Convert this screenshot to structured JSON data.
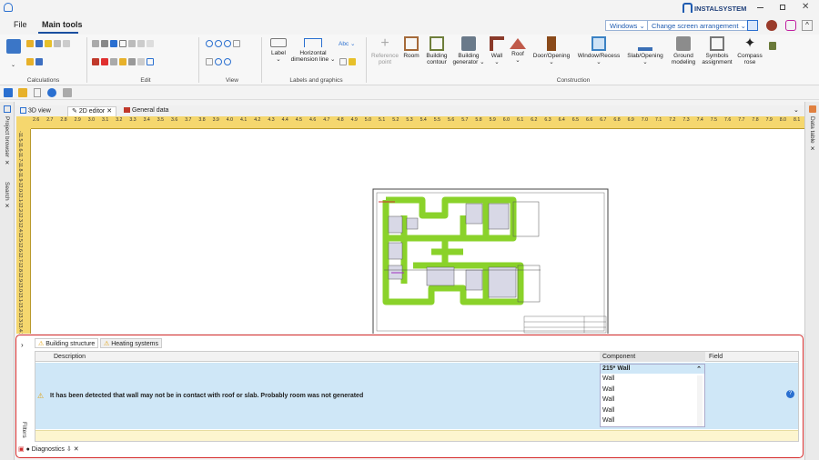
{
  "app": {
    "logo_text": "INSTALSYSTEM"
  },
  "menu": {
    "file": "File",
    "main_tools": "Main tools"
  },
  "topbar": {
    "windows": "Windows",
    "arrangement": "Change screen arrangement"
  },
  "ribbon": {
    "groups": {
      "calculations": "Calculations",
      "edit": "Edit",
      "view": "View",
      "labels": "Labels and graphics",
      "construction": "Construction"
    },
    "labels_buttons": {
      "label": "Label",
      "hdim": "Horizontal dimension line",
      "abc": "Abc"
    },
    "construction_buttons": {
      "reference_point": "Reference point",
      "room": "Room",
      "building_contour": "Building contour",
      "building_generator": "Building generator",
      "wall": "Wall",
      "roof": "Roof",
      "door_opening": "Door/Opening",
      "window_recess": "Window/Recess",
      "slab_opening": "Slab/Opening",
      "ground_modeling": "Ground modeling",
      "symbols_assignment": "Symbols assignment",
      "compass_rose": "Compass rose"
    }
  },
  "tabs": {
    "view3d": "3D view",
    "editor2d": "2D editor",
    "general": "General data"
  },
  "side": {
    "project_browser": "Project browser",
    "search": "Search",
    "data_table": "Data table",
    "filters": "Filters"
  },
  "ruler": {
    "top": [
      "2.6",
      "2.7",
      "2.8",
      "2.9",
      "3.0",
      "3.1",
      "3.2",
      "3.3",
      "3.4",
      "3.5",
      "3.6",
      "3.7",
      "3.8",
      "3.9",
      "4.0",
      "4.1",
      "4.2",
      "4.3",
      "4.4",
      "4.5",
      "4.6",
      "4.7",
      "4.8",
      "4.9",
      "5.0",
      "5.1",
      "5.2",
      "5.3",
      "5.4",
      "5.5",
      "5.6",
      "5.7",
      "5.8",
      "5.9",
      "6.0",
      "6.1",
      "6.2",
      "6.3",
      "6.4",
      "6.5",
      "6.6",
      "6.7",
      "6.8",
      "6.9",
      "7.0",
      "7.1",
      "7.2",
      "7.3",
      "7.4",
      "7.5",
      "7.6",
      "7.7",
      "7.8",
      "7.9",
      "8.0",
      "8.1"
    ],
    "left": [
      "-11.5",
      "-11.6",
      "-11.7",
      "-11.8",
      "-11.9",
      "-12.0",
      "-12.1",
      "-12.2",
      "-12.3",
      "-12.4",
      "-12.5",
      "-12.6",
      "-12.7",
      "-12.8",
      "-12.9",
      "-13.0",
      "-13.1",
      "-13.2",
      "-13.3",
      "-13.4",
      "-13.5"
    ]
  },
  "diagnostics": {
    "tabs": [
      "Building structure",
      "Heating systems"
    ],
    "columns": {
      "description": "Description",
      "component": "Component",
      "field": "Field"
    },
    "message": "It has been detected that wall may not be in contact with roof or slab. Probably room was not generated",
    "selected_component": "215* Wall",
    "components": [
      "Wall",
      "Wall",
      "Wall",
      "Wall",
      "Wall"
    ],
    "panel_title": "Diagnostics"
  }
}
